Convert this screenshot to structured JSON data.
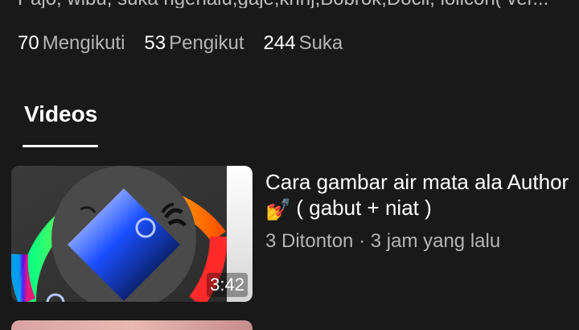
{
  "profile": {
    "bio_partial": "Pajo, wibu, suka ngehalu,gaje,krinj,Bobrok,Docil, lolicon( ver...",
    "stats": {
      "following": {
        "count": "70",
        "label": "Mengikuti"
      },
      "followers": {
        "count": "53",
        "label": "Pengikut"
      },
      "likes": {
        "count": "244",
        "label": "Suka"
      }
    }
  },
  "tabs": {
    "active": {
      "label": "Videos"
    }
  },
  "videos": [
    {
      "title": "Cara gambar air mata ala Author",
      "title_line2": "( gabut + niat )",
      "emoji": "💅",
      "views": "3 Ditonton",
      "separator": "·",
      "age": "3 jam yang lalu",
      "duration": "3:42"
    }
  ],
  "colors": {
    "background": "#191919",
    "text_primary": "#ffffff",
    "text_secondary": "#b5b5b5"
  },
  "icons": {
    "nail_polish": "nail-polish-emoji"
  }
}
